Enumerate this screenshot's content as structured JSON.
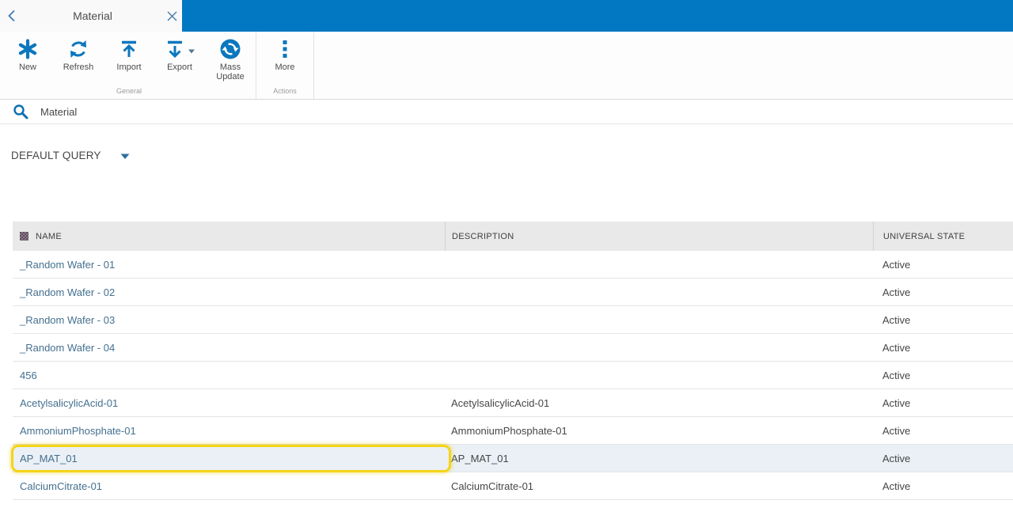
{
  "window": {
    "tab_title": "Material",
    "back_icon": "chevron-left-icon",
    "close_icon": "close-x-icon"
  },
  "toolbar": {
    "groups": [
      {
        "label": "General",
        "buttons": [
          {
            "label": "New",
            "icon": "new-asterisk-icon"
          },
          {
            "label": "Refresh",
            "icon": "refresh-icon"
          },
          {
            "label": "Import",
            "icon": "import-arrow-up-icon"
          },
          {
            "label": "Export",
            "icon": "export-arrow-down-icon",
            "has_dropdown": true
          },
          {
            "label": "Mass Update",
            "icon": "mass-update-sync-icon"
          }
        ]
      },
      {
        "label": "Actions",
        "buttons": [
          {
            "label": "More",
            "icon": "more-vertical-dots-icon"
          }
        ]
      }
    ]
  },
  "search": {
    "value": "Material",
    "icon": "search-icon"
  },
  "query": {
    "selected": "DEFAULT QUERY",
    "icon": "chevron-down-icon"
  },
  "table": {
    "columns": [
      {
        "label": "NAME"
      },
      {
        "label": "DESCRIPTION"
      },
      {
        "label": "UNIVERSAL STATE"
      }
    ],
    "rows": [
      {
        "name": "_Random Wafer - 01",
        "description": "",
        "state": "Active",
        "highlighted": false
      },
      {
        "name": "_Random Wafer - 02",
        "description": "",
        "state": "Active",
        "highlighted": false
      },
      {
        "name": "_Random Wafer - 03",
        "description": "",
        "state": "Active",
        "highlighted": false
      },
      {
        "name": "_Random Wafer - 04",
        "description": "",
        "state": "Active",
        "highlighted": false
      },
      {
        "name": "456",
        "description": "",
        "state": "Active",
        "highlighted": false
      },
      {
        "name": "AcetylsalicylicAcid-01",
        "description": "AcetylsalicylicAcid-01",
        "state": "Active",
        "highlighted": false
      },
      {
        "name": "AmmoniumPhosphate-01",
        "description": "AmmoniumPhosphate-01",
        "state": "Active",
        "highlighted": false
      },
      {
        "name": "AP_MAT_01",
        "description": "AP_MAT_01",
        "state": "Active",
        "highlighted": true
      },
      {
        "name": "CalciumCitrate-01",
        "description": "CalciumCitrate-01",
        "state": "Active",
        "highlighted": false
      }
    ]
  },
  "colors": {
    "accent_blue": "#0278c2",
    "icon_blue": "#0b77bd",
    "link_blue": "#44708f",
    "highlight_border_yellow": "#f4d418",
    "highlight_row_bg": "#eaf0f5",
    "header_bg": "#e9e9e9"
  }
}
